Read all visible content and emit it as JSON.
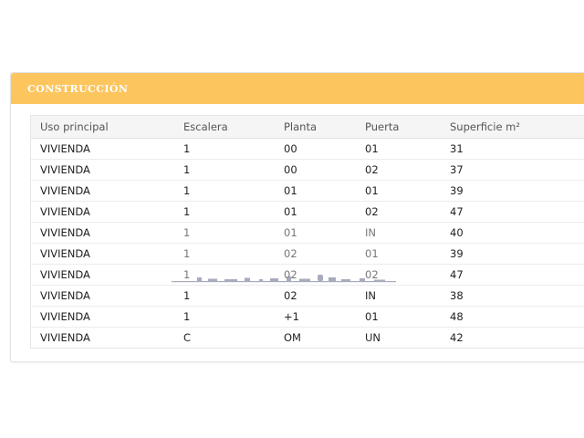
{
  "panel": {
    "title": "CONSTRUCCIÓN"
  },
  "table": {
    "headers": {
      "uso": "Uso principal",
      "escalera": "Escalera",
      "planta": "Planta",
      "puerta": "Puerta",
      "superficie": "Superficie m²"
    },
    "rows": [
      {
        "uso": "VIVIENDA",
        "escalera": "1",
        "planta": "00",
        "puerta": "01",
        "superficie": "31"
      },
      {
        "uso": "VIVIENDA",
        "escalera": "1",
        "planta": "00",
        "puerta": "02",
        "superficie": "37"
      },
      {
        "uso": "VIVIENDA",
        "escalera": "1",
        "planta": "01",
        "puerta": "01",
        "superficie": "39"
      },
      {
        "uso": "VIVIENDA",
        "escalera": "1",
        "planta": "01",
        "puerta": "02",
        "superficie": "47"
      },
      {
        "uso": "VIVIENDA",
        "escalera": "1",
        "planta": "01",
        "puerta": "IN",
        "superficie": "40"
      },
      {
        "uso": "VIVIENDA",
        "escalera": "1",
        "planta": "02",
        "puerta": "01",
        "superficie": "39"
      },
      {
        "uso": "VIVIENDA",
        "escalera": "1",
        "planta": "02",
        "puerta": "02",
        "superficie": "47"
      },
      {
        "uso": "VIVIENDA",
        "escalera": "1",
        "planta": "02",
        "puerta": "IN",
        "superficie": "38"
      },
      {
        "uso": "VIVIENDA",
        "escalera": "1",
        "planta": "+1",
        "puerta": "01",
        "superficie": "48"
      },
      {
        "uso": "VIVIENDA",
        "escalera": "C",
        "planta": "OM",
        "puerta": "UN",
        "superficie": "42"
      }
    ]
  },
  "colors": {
    "header_bg": "#fcc55e",
    "header_text": "#ffffff"
  }
}
